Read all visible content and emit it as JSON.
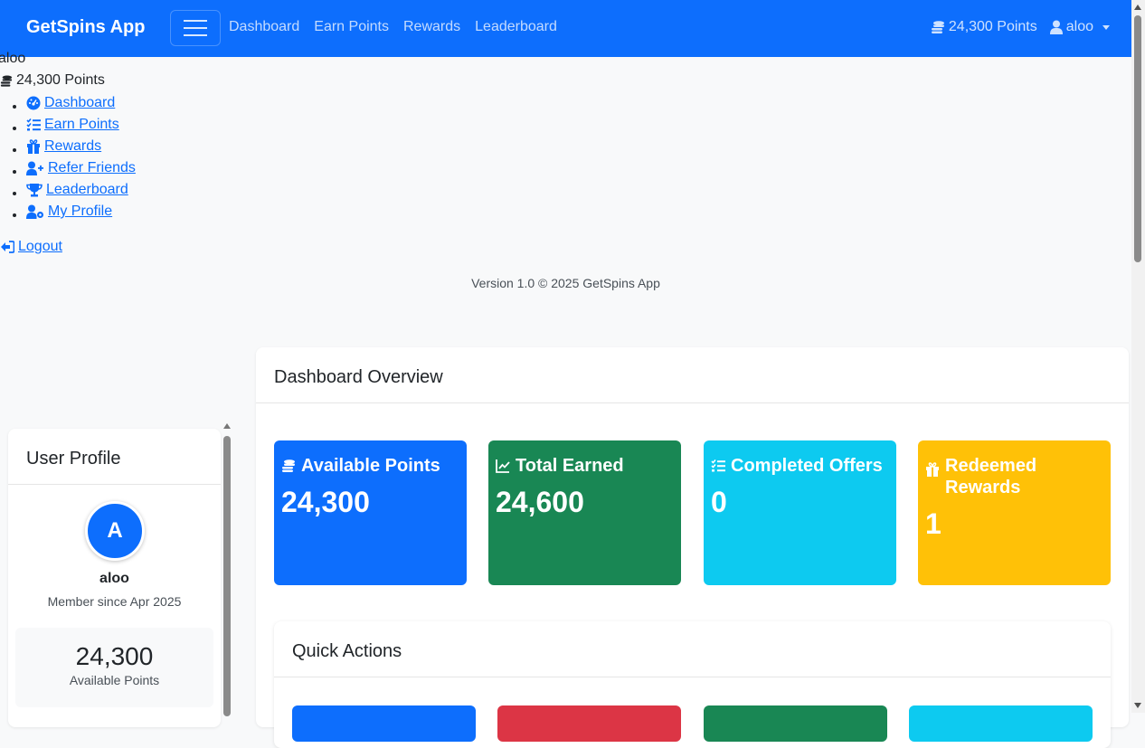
{
  "navbar": {
    "brand": "GetSpins App",
    "links": [
      "Dashboard",
      "Earn Points",
      "Rewards",
      "Leaderboard"
    ],
    "points": "24,300 Points",
    "username": "aloo"
  },
  "sidebar": {
    "username": "aloo",
    "points": "24,300 Points",
    "items": [
      {
        "label": " Dashboard",
        "icon": "dashboard-icon"
      },
      {
        "label": " Earn Points",
        "icon": "tasks-icon"
      },
      {
        "label": " Rewards",
        "icon": "gift-icon"
      },
      {
        "label": " Refer Friends",
        "icon": "user-plus-icon"
      },
      {
        "label": " Leaderboard",
        "icon": "trophy-icon"
      },
      {
        "label": " My Profile",
        "icon": "user-cog-icon"
      }
    ],
    "logout": " Logout",
    "version": "Version 1.0 © 2025 GetSpins App"
  },
  "profile": {
    "title": "User Profile",
    "avatar_letter": "A",
    "name": "aloo",
    "member_since": "Member since Apr 2025",
    "points_value": "24,300",
    "points_label": "Available Points"
  },
  "dashboard": {
    "title": "Dashboard Overview",
    "stats": [
      {
        "label": "Available Points",
        "value": "24,300",
        "color": "#0d6efd",
        "icon": "coins-icon"
      },
      {
        "label": "Total Earned",
        "value": "24,600",
        "color": "#198754",
        "icon": "chart-line-icon"
      },
      {
        "label": "Completed Offers",
        "value": "0",
        "color": "#0dcaf0",
        "icon": "tasks-icon"
      },
      {
        "label": "Redeemed Rewards",
        "value": "1",
        "color": "#ffc107",
        "icon": "gift-icon"
      }
    ],
    "quick_actions_title": "Quick Actions"
  }
}
